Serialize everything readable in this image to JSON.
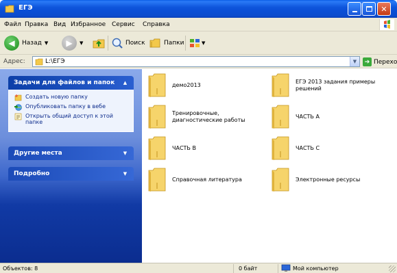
{
  "window": {
    "title": "ЕГЭ"
  },
  "menu": [
    {
      "label": "Файл"
    },
    {
      "label": "Правка"
    },
    {
      "label": "Вид"
    },
    {
      "label": "Избранное"
    },
    {
      "label": "Сервис"
    },
    {
      "label": "Справка"
    }
  ],
  "toolbar": {
    "back_label": "Назад",
    "search_label": "Поиск",
    "folders_label": "Папки"
  },
  "address": {
    "label": "Адрес:",
    "value": "L:\\ЕГЭ",
    "go_label": "Переход"
  },
  "taskpane": {
    "file_tasks": {
      "title": "Задачи для файлов и папок",
      "items": [
        {
          "label": "Создать новую папку"
        },
        {
          "label": "Опубликовать папку в вебе"
        },
        {
          "label": "Открыть общий доступ к этой папке"
        }
      ]
    },
    "other_places": {
      "title": "Другие места"
    },
    "details": {
      "title": "Подробно"
    }
  },
  "folders": [
    {
      "name": "демо2013"
    },
    {
      "name": "ЕГЭ 2013 задания примеры решений"
    },
    {
      "name": "Тренировочные, диагностические работы"
    },
    {
      "name": "ЧАСТЬ А"
    },
    {
      "name": "ЧАСТЬ В"
    },
    {
      "name": "ЧАСТЬ С"
    },
    {
      "name": "Справочная литература"
    },
    {
      "name": "Электронные ресурсы"
    }
  ],
  "status": {
    "objects": "Объектов: 8",
    "size": "0 байт",
    "location": "Мой компьютер"
  },
  "colors": {
    "titlebar": "#0a4fd6",
    "chrome": "#ece9d8",
    "taskpane_link": "#0c2b8c",
    "folder": "#f3c94b"
  }
}
